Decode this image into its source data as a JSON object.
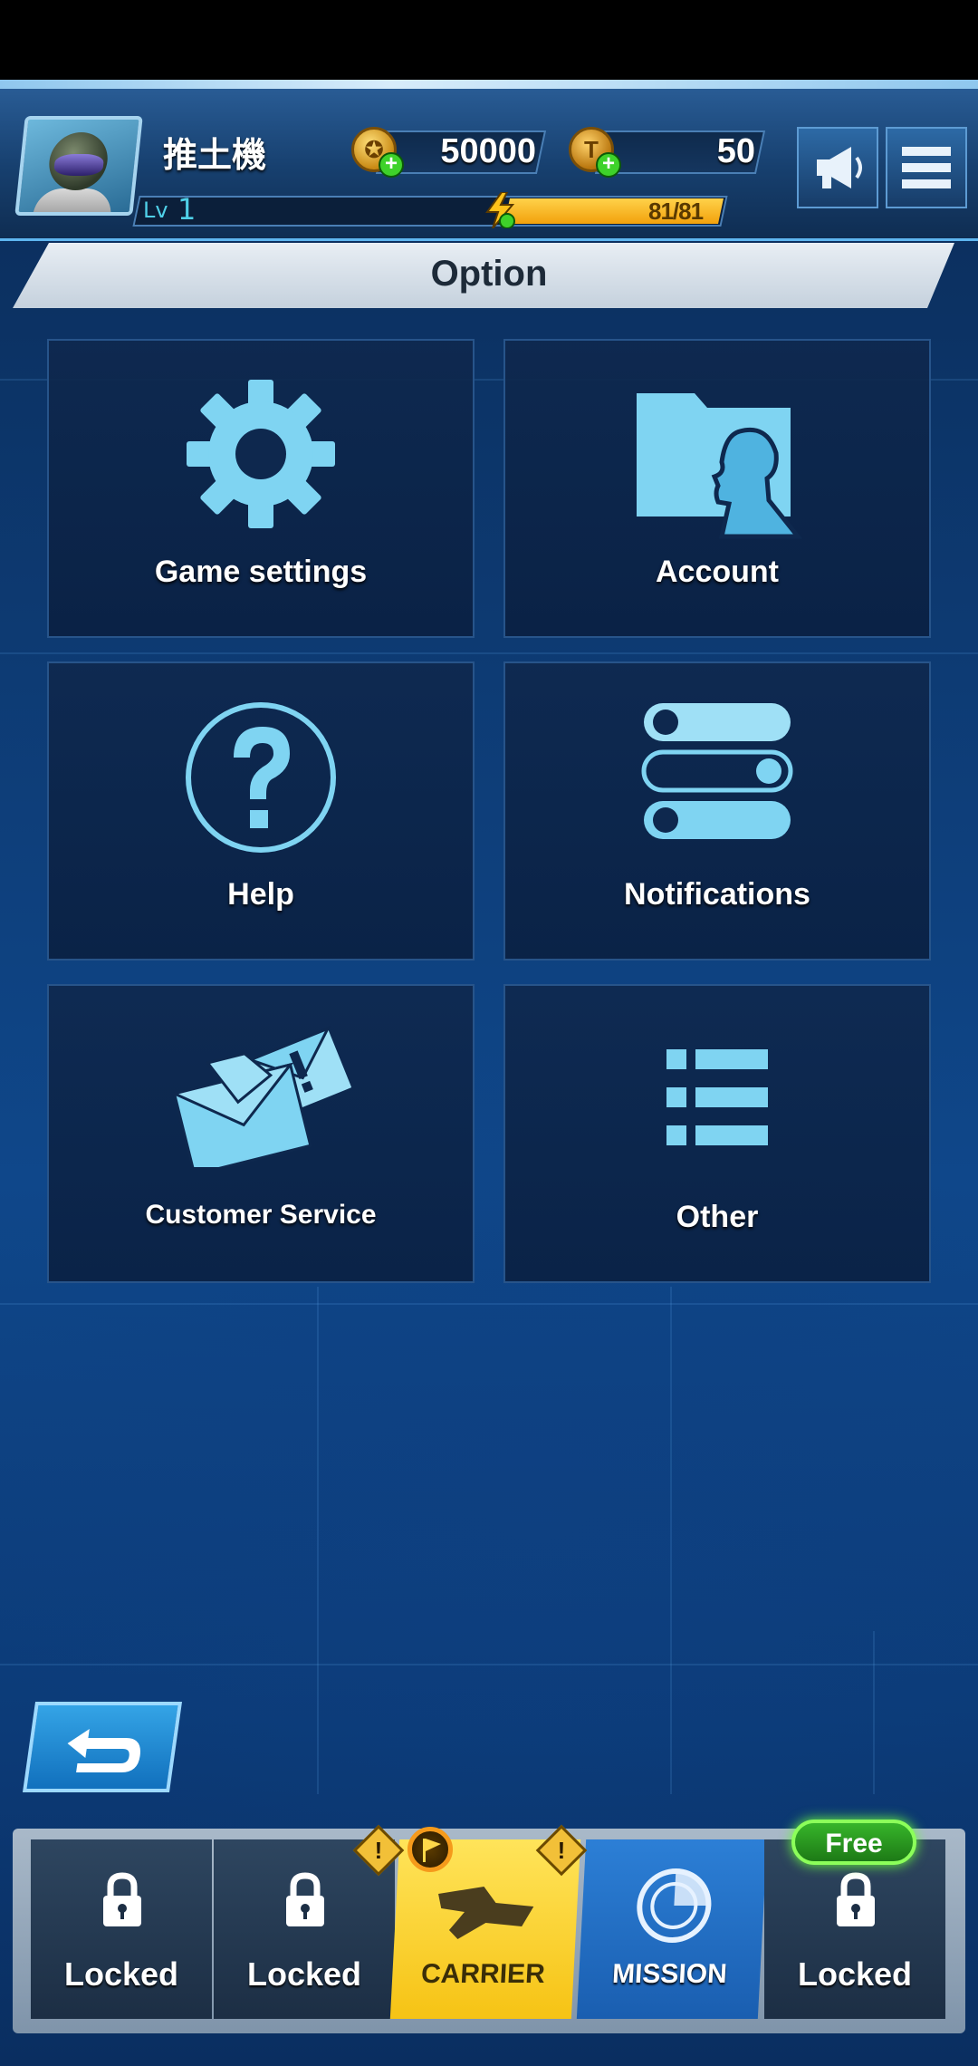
{
  "header": {
    "player_name": "推土機",
    "level_label": "Lv",
    "level": "1",
    "energy": "81/81",
    "currencies": [
      {
        "name": "gold",
        "value": "50000"
      },
      {
        "name": "ticket",
        "value": "50"
      }
    ]
  },
  "page_title": "Option",
  "options": [
    {
      "label": "Game settings",
      "icon": "gear-icon"
    },
    {
      "label": "Account",
      "icon": "folder-person-icon"
    },
    {
      "label": "Help",
      "icon": "question-icon"
    },
    {
      "label": "Notifications",
      "icon": "toggles-icon"
    },
    {
      "label": "Customer Service",
      "icon": "mail-icon"
    },
    {
      "label": "Other",
      "icon": "list-icon"
    }
  ],
  "bottom_nav": {
    "items": [
      {
        "label": "Locked",
        "state": "locked"
      },
      {
        "label": "Locked",
        "state": "locked"
      },
      {
        "label": "CARRIER",
        "state": "active"
      },
      {
        "label": "MISSION",
        "state": "normal"
      },
      {
        "label": "Locked",
        "state": "locked"
      }
    ],
    "free_badge": "Free"
  },
  "colors": {
    "accent": "#5fc8ee",
    "energy": "#f2a10c",
    "carrier": "#ffd42a",
    "mission": "#2270c8",
    "free": "#3cc82a"
  }
}
